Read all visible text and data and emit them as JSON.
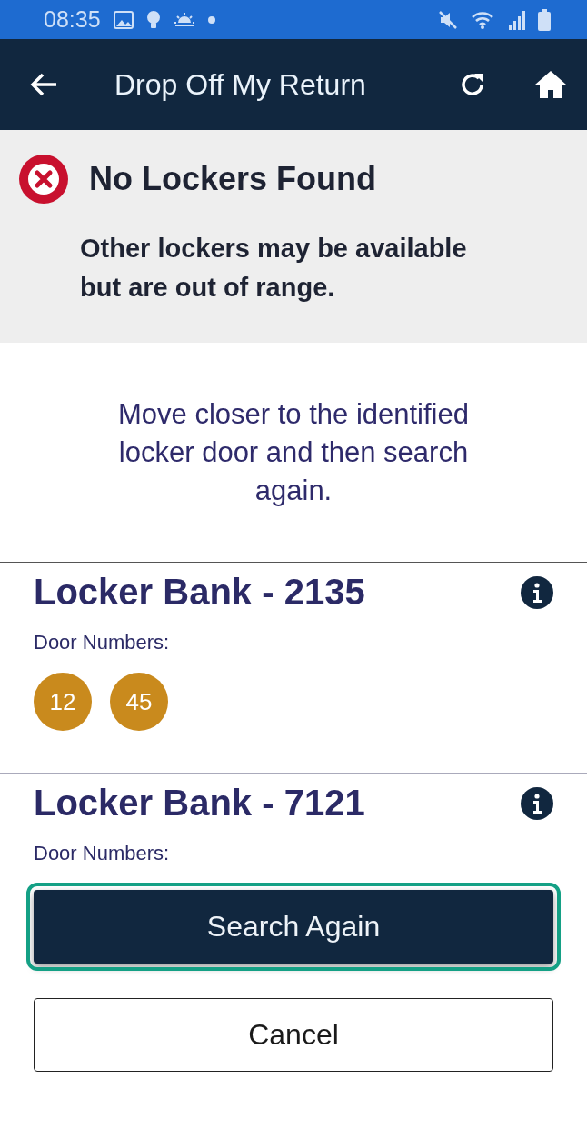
{
  "status_bar": {
    "time": "08:35"
  },
  "app_bar": {
    "title": "Drop Off My Return"
  },
  "alert": {
    "title": "No Lockers Found",
    "message": "Other lockers may be available but are out of range."
  },
  "instruction": "Move closer to the identified locker door and then search again.",
  "locker_banks": [
    {
      "title": "Locker Bank - 2135",
      "door_label": "Door Numbers:",
      "doors": [
        "12",
        "45"
      ]
    },
    {
      "title": "Locker Bank - 7121",
      "door_label": "Door Numbers:"
    }
  ],
  "buttons": [
    {
      "label": "Search Again",
      "kind": "primary",
      "focused": true
    },
    {
      "label": "Cancel",
      "kind": "secondary",
      "focused": false
    }
  ]
}
